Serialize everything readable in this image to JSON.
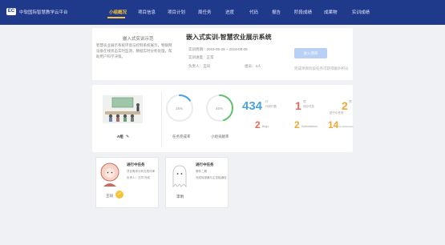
{
  "topbar": {
    "logo_badge": "EC",
    "app_title": "中软国际智慧教学云平台",
    "nav": [
      {
        "label": "小组概况",
        "active": true
      },
      {
        "label": "项目信息"
      },
      {
        "label": "项目计划"
      },
      {
        "label": "周任务"
      },
      {
        "label": "进度"
      },
      {
        "label": "代码"
      },
      {
        "label": "报告"
      },
      {
        "label": "阶段成绩"
      },
      {
        "label": "成果物"
      },
      {
        "label": "实训成绩"
      }
    ]
  },
  "project": {
    "small_title": "嵌入式实训示范",
    "description": "智慧农业展示系统环境与控制系统展示，物联网设备在线状态实时监测，数据实时分析处理，帮助用户科学决策。",
    "title": "嵌入式实训-智慧农业展示系统",
    "date_range": "实训周期：2019-05-29 ~ 2019-08-08",
    "status": "实训进度：正常",
    "leader": "负责人：王同",
    "members": "组员：4人",
    "enter_button": "进入项目",
    "tip": "完成项目阶段任务可获得额外积分"
  },
  "stats": {
    "group_name": "A组",
    "progress_ring": {
      "value": 15,
      "label": "15%",
      "caption": "任务完成率"
    },
    "score_ring": {
      "value": 45,
      "label": "45%",
      "caption": "小组贡献率"
    },
    "code_lines": {
      "value": "434",
      "unit": "行",
      "sub": "代码行数"
    },
    "tasks_a": {
      "value": "1",
      "unit": "项",
      "sub": "待办任务"
    },
    "tasks_b": {
      "value": "2",
      "unit": "项",
      "sub": "进行中任务"
    },
    "bugs": {
      "value": "2",
      "sub": "Bugs"
    },
    "submissions": {
      "value": "2",
      "sub": "Submissions"
    },
    "contributions": {
      "value": "14",
      "sub": "Contributions"
    },
    "colors": {
      "blue": "#4aa3df",
      "green": "#5ec26a",
      "red": "#e8685c",
      "orange": "#f0a830"
    }
  },
  "tasks": [
    {
      "title": "进行中任务",
      "line1": "项目需求分析文档评审",
      "line2": "负责人：王同 完成",
      "user": "王同"
    },
    {
      "title": "进行中任务",
      "line1": "硬件二期",
      "line2": "完成传感器与主控板通信",
      "user": "李明"
    }
  ]
}
